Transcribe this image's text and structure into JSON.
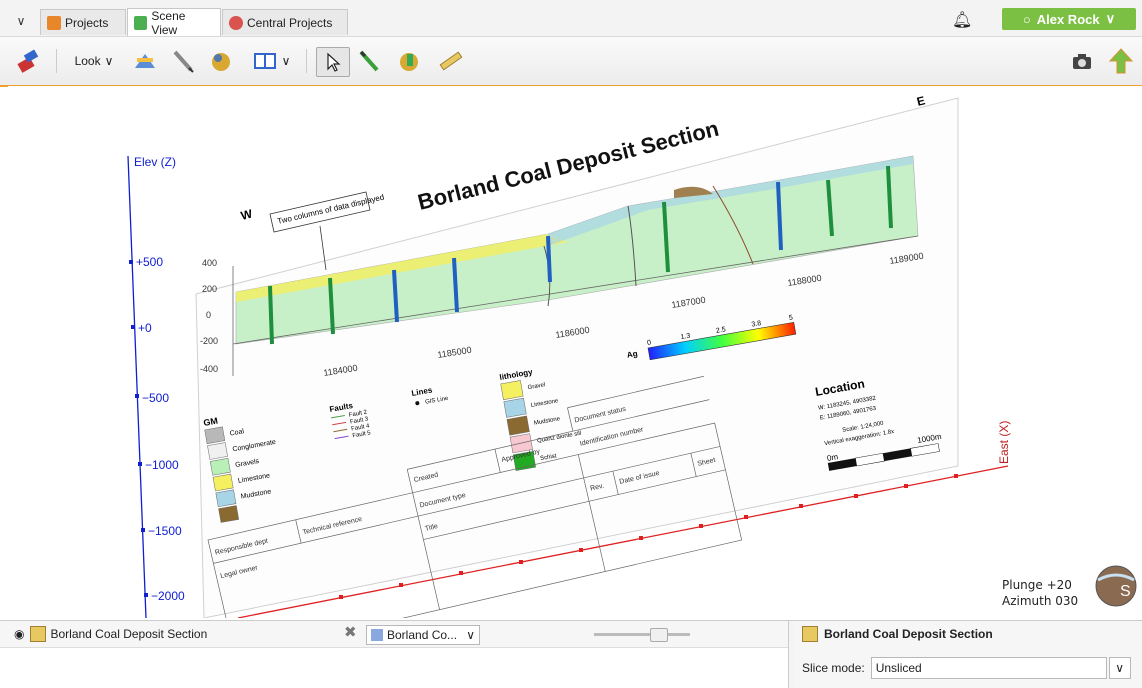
{
  "tabs": [
    {
      "label": "Projects",
      "color": "#e8862a"
    },
    {
      "label": "Scene View",
      "color": "#4caf50"
    },
    {
      "label": "Central Projects",
      "color": "#d9534f"
    }
  ],
  "user": {
    "name": "Alex Rock"
  },
  "toolbar": {
    "look_label": "Look",
    "icons": [
      "draw-plane-icon",
      "new-slice-icon",
      "draw-line-icon",
      "interpolation-icon",
      "layout-icon",
      "select-icon",
      "draw-polyline-icon",
      "edit-icon",
      "ruler-icon",
      "screenshot-icon",
      "share-icon"
    ]
  },
  "scene": {
    "elev_axis": {
      "label": "Elev (Z)",
      "ticks": [
        "+500",
        "+0",
        "−500",
        "−1000",
        "−1500",
        "−2000"
      ]
    },
    "east_axis": {
      "label": "East (X)"
    },
    "section_title": "Borland Coal Deposit Section",
    "w_label": "W",
    "e_label": "E",
    "callout": "Two columns of data displayed",
    "y_ticks": [
      "400",
      "200",
      "0",
      "-200",
      "-400"
    ],
    "x_ticks": [
      "1184000",
      "1185000",
      "1186000",
      "1187000",
      "1188000",
      "1189000"
    ],
    "color_scale": {
      "label": "Ag",
      "ticks": [
        "0",
        "1.3",
        "2.5",
        "3.8",
        "5"
      ]
    },
    "gm_legend": {
      "title": "GM",
      "items": [
        {
          "label": "Coal",
          "color": "#b8b8b8"
        },
        {
          "label": "Conglomerate",
          "color": "#f0f0f0"
        },
        {
          "label": "Gravels",
          "color": "#b8f0b8"
        },
        {
          "label": "Limestone",
          "color": "#f4f060"
        },
        {
          "label": "Mudstone",
          "color": "#a8d4e8"
        },
        {
          "label": "",
          "color": "#8a6a30"
        }
      ]
    },
    "faults_legend": {
      "title": "Faults",
      "items": [
        {
          "label": "Fault 2",
          "color": "#4aa04a"
        },
        {
          "label": "Fault 3",
          "color": "#cc4444"
        },
        {
          "label": "Fault 4",
          "color": "#8a6a30"
        },
        {
          "label": "Fault 5",
          "color": "#8844cc"
        }
      ]
    },
    "lines_legend": {
      "title": "Lines",
      "items": [
        {
          "label": "GIS Line"
        }
      ]
    },
    "lithology_legend": {
      "title": "lithology",
      "items": [
        {
          "label": "Gravel",
          "color": "#f4f060"
        },
        {
          "label": "Limestone",
          "color": "#a8d4e8"
        },
        {
          "label": "Mudstone",
          "color": "#8a6a30"
        },
        {
          "label": "Quartz diorite sill",
          "color": "#f8c8d0"
        },
        {
          "label": "Schist",
          "color": "#22aa22"
        }
      ]
    },
    "location": {
      "title": "Location",
      "w": "W:   1183245, 4903382",
      "e": "E:   1189060, 4901763",
      "scale": "Scale: 1:24,000",
      "exag": "Vertical exaggeration: 1.8x",
      "bar_start": "0m",
      "bar_end": "1000m"
    },
    "titleblock": {
      "responsible_dept": "Responsible dept",
      "technical_reference": "Technical reference",
      "created_by": "Created",
      "approved_by": "Approved by",
      "document_status": "Document status",
      "document_type": "Document type",
      "identification_number": "Identification number",
      "legal_owner": "Legal owner",
      "title": "Title",
      "rev": "Rev.",
      "date_of_issue": "Date of issue",
      "sheet": "Sheet"
    },
    "orientation": {
      "plunge": "Plunge +20",
      "azimuth": "Azimuth 030"
    }
  },
  "bottom": {
    "left_title": "Borland Coal Deposit Section",
    "dropdown_value": "Borland Co...",
    "right_title": "Borland Coal Deposit Section",
    "slice_mode_label": "Slice mode:",
    "slice_mode_value": "Unsliced"
  }
}
